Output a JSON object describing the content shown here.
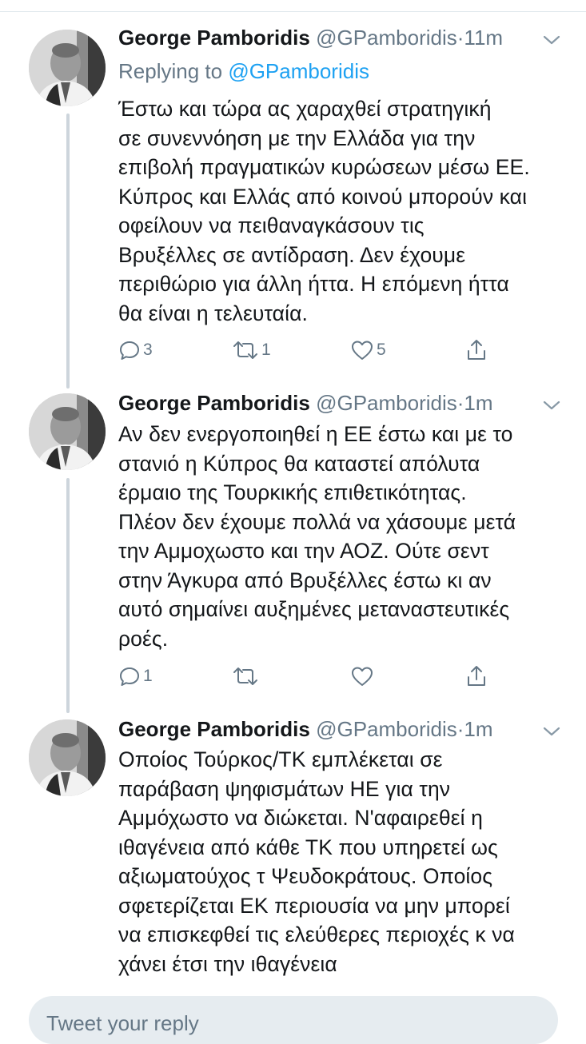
{
  "composer": {
    "placeholder": "Tweet your reply"
  },
  "tweets": [
    {
      "name": "George Pamboridis",
      "handle": "@GPamboridis",
      "separator": "·",
      "time": "11m",
      "reply_prefix": "Replying to",
      "reply_mention": "@GPamboridis",
      "text": "Έστω και τώρα ας χαραχθεί στρατηγική\nσε συνεννόηση με την Ελλάδα για την\nεπιβολή πραγματικών κυρώσεων μέσω ΕΕ.\nΚύπρος και Ελλάς από κοινού μπορούν και\nοφείλουν να πειθαναγκάσουν τις\nΒρυξέλλες σε αντίδραση. Δεν έχουμε\nπεριθώριο για άλλη ήττα. Η επόμενη ήττα\nθα είναι η τελευταία.",
      "replies": "3",
      "retweets": "1",
      "likes": "5"
    },
    {
      "name": "George Pamboridis",
      "handle": "@GPamboridis",
      "separator": "·",
      "time": "1m",
      "text": "Αν δεν ενεργοποιηθεί η ΕΕ έστω και με το\nστανιό η Κύπρος θα καταστεί απόλυτα\nέρμαιο της Τουρκικής επιθετικότητας.\nΠλέον δεν έχουμε πολλά να χάσουμε μετά\nτην Αμμοχωστο και την ΑΟΖ. Ούτε σεντ\nστην Άγκυρα από Βρυξέλλες έστω κι αν\nαυτό σημαίνει αυξημένες μεταναστευτικές\nροές.",
      "replies": "1",
      "retweets": "",
      "likes": ""
    },
    {
      "name": "George Pamboridis",
      "handle": "@GPamboridis",
      "separator": "·",
      "time": "1m",
      "text": "Οποίος Τούρκος/ΤΚ εμπλέκεται σε\nπαράβαση ψηφισμάτων ΗΕ για την\nΑμμόχωστο να διώκεται. Ν'αφαιρεθεί η\nιθαγένεια από κάθε ΤΚ που υπηρετεί ως\nαξιωματούχος τ Ψευδοκράτους. Οποίος\nσφετερίζεται ΕΚ περιουσία να μην μπορεί\nνα επισκεφθεί τις ελεύθερες περιοχές κ να\nχάνει έτσι την ιθαγένεια"
    }
  ]
}
